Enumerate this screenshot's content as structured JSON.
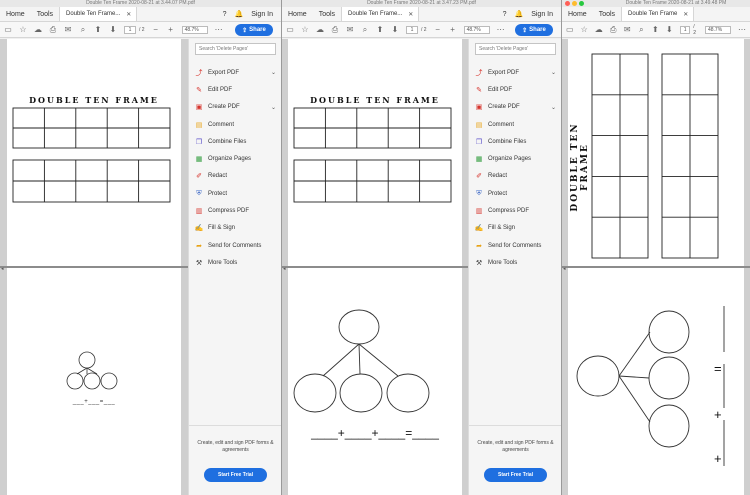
{
  "windows": [
    {
      "title": "Double Ten Frame 2020-08-21 at 3.44.07 PM.pdf",
      "menu": [
        "Home",
        "Tools"
      ],
      "tab_label": "Double Ten Frame...",
      "signin": "Sign In",
      "page_current": "1",
      "page_total": "/ 2",
      "zoom": "48.7%",
      "share": "Share",
      "frame_title": "DOUBLE TEN FRAME",
      "blanks": "___+___=___"
    },
    {
      "title": "Double Ten Frame 2020-08-21 at 3.47.23 PM.pdf",
      "menu": [
        "Home",
        "Tools"
      ],
      "tab_label": "Double Ten Frame...",
      "signin": "Sign In",
      "page_current": "1",
      "page_total": "/ 2",
      "zoom": "48.7%",
      "share": "Share",
      "frame_title": "DOUBLE TEN FRAME",
      "blanks": "____+____+____=____"
    },
    {
      "title": "Double Ten Frame 2020-08-21 at 3.49.48 PM",
      "menu": [
        "Home",
        "Tools"
      ],
      "tab_label": "Double Ten Frame",
      "page_current": "1",
      "page_total": "/ 2",
      "zoom": "48.7%",
      "frame_title": "DOUBLE TEN FRAME",
      "blanks": [
        "=",
        "+",
        "+"
      ]
    }
  ],
  "tools_pane": {
    "search_placeholder": "Search 'Delete Pages'",
    "items": [
      {
        "label": "Export PDF",
        "icon": "export-pdf-icon",
        "color": "#d6322b",
        "chevron": true
      },
      {
        "label": "Edit PDF",
        "icon": "edit-pdf-icon",
        "color": "#d6322b",
        "chevron": false
      },
      {
        "label": "Create PDF",
        "icon": "create-pdf-icon",
        "color": "#d6322b",
        "chevron": true
      },
      {
        "label": "Comment",
        "icon": "comment-icon",
        "color": "#e8a317",
        "chevron": false
      },
      {
        "label": "Combine Files",
        "icon": "combine-files-icon",
        "color": "#5a4fc9",
        "chevron": false
      },
      {
        "label": "Organize Pages",
        "icon": "organize-pages-icon",
        "color": "#2e9b3b",
        "chevron": false
      },
      {
        "label": "Redact",
        "icon": "redact-icon",
        "color": "#d6322b",
        "chevron": false
      },
      {
        "label": "Protect",
        "icon": "protect-icon",
        "color": "#3966c6",
        "chevron": false
      },
      {
        "label": "Compress PDF",
        "icon": "compress-pdf-icon",
        "color": "#d6322b",
        "chevron": false
      },
      {
        "label": "Fill & Sign",
        "icon": "fill-sign-icon",
        "color": "#7a3fc2",
        "chevron": false
      },
      {
        "label": "Send for Comments",
        "icon": "send-comments-icon",
        "color": "#e8a317",
        "chevron": false
      },
      {
        "label": "More Tools",
        "icon": "more-tools-icon",
        "color": "#444444",
        "chevron": false
      }
    ],
    "promo_text": "Create, edit and sign PDF forms & agreements",
    "trial_button": "Start Free Trial"
  },
  "colors": {
    "accent": "#1f6fe0",
    "traffic_close": "#ff5f57",
    "traffic_min": "#febc2e",
    "traffic_max": "#28c840"
  }
}
